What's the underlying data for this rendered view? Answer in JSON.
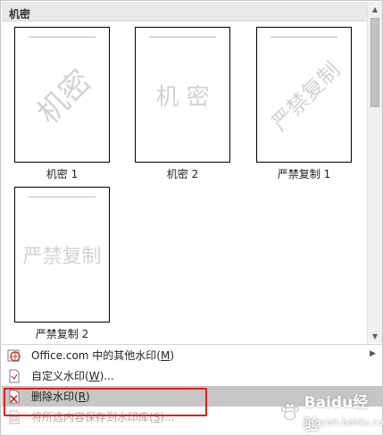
{
  "section_title": "机密",
  "watermarks": [
    {
      "caption": "机密 1",
      "text": "机密",
      "style": "diagonal"
    },
    {
      "caption": "机密 2",
      "text": "机 密",
      "style": "horizontal"
    },
    {
      "caption": "严禁复制 1",
      "text": "严禁复制",
      "style": "diagonal"
    },
    {
      "caption": "严禁复制 2",
      "text": "严禁复制",
      "style": "horizontal"
    }
  ],
  "menu": {
    "office_more": {
      "prefix": "Office.com 中的其他水印(",
      "key": "M",
      "suffix": ")"
    },
    "custom": {
      "prefix": "自定义水印(",
      "key": "W",
      "suffix": ")..."
    },
    "remove": {
      "prefix": "删除水印(",
      "key": "R",
      "suffix": ")"
    },
    "save_selection": {
      "prefix": "将所选内容保存到水印库(",
      "key": "S",
      "suffix": ")..."
    }
  },
  "brand": {
    "text": "Baidu经验",
    "sub": "jingyan.baidu.com"
  },
  "colors": {
    "highlight": "#c6c6c6",
    "callout": "#e02020",
    "watermark_gray": "#d2d2d2"
  }
}
